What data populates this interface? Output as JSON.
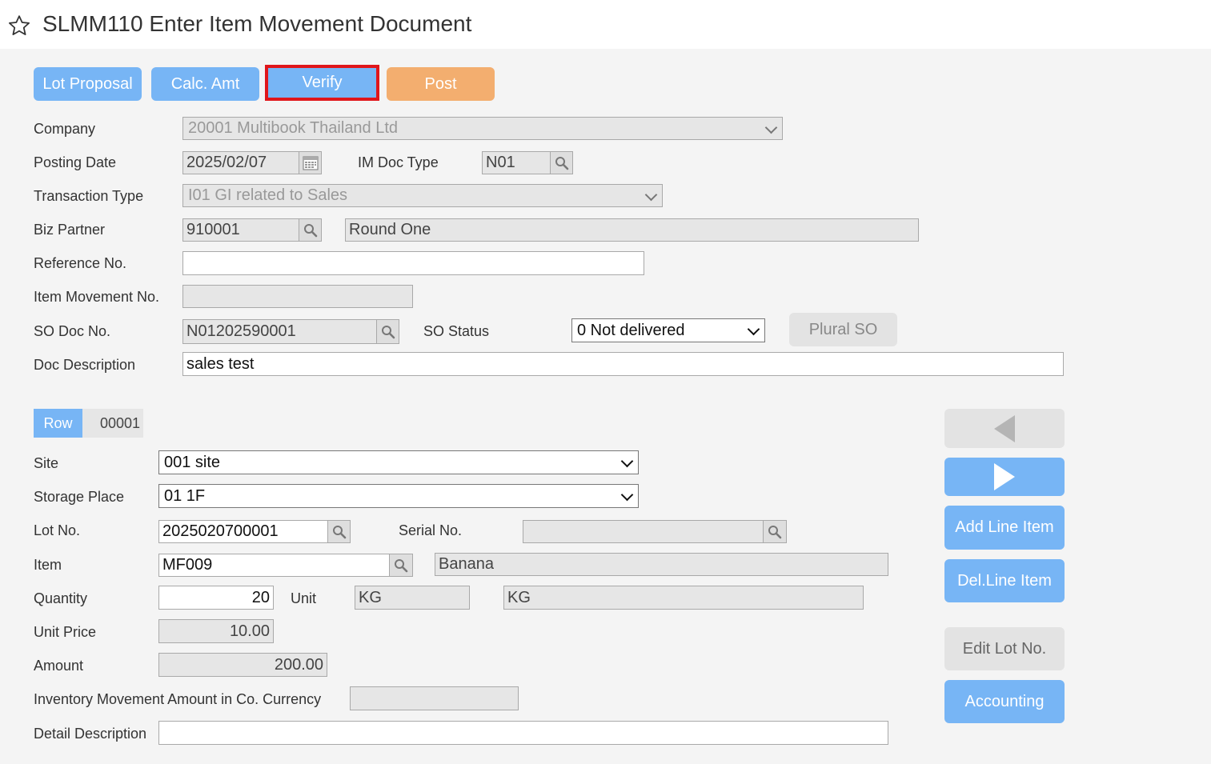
{
  "header": {
    "title": "SLMM110 Enter Item Movement Document",
    "favorite_icon": "star-outline-icon"
  },
  "toolbar": {
    "lot_proposal": "Lot Proposal",
    "calc_amt": "Calc. Amt",
    "verify": "Verify",
    "post": "Post"
  },
  "form": {
    "company_label": "Company",
    "company_value": "20001 Multibook Thailand Ltd",
    "posting_date_label": "Posting Date",
    "posting_date_value": "2025/02/07",
    "im_doc_type_label": "IM Doc Type",
    "im_doc_type_value": "N01",
    "transaction_type_label": "Transaction Type",
    "transaction_type_value": "I01 GI related to Sales",
    "biz_partner_label": "Biz Partner",
    "biz_partner_code": "910001",
    "biz_partner_name": "Round One",
    "reference_no_label": "Reference No.",
    "reference_no_value": "",
    "item_movement_no_label": "Item Movement No.",
    "item_movement_no_value": "",
    "so_doc_no_label": "SO Doc No.",
    "so_doc_no_value": "N01202590001",
    "so_status_label": "SO Status",
    "so_status_value": "0 Not delivered",
    "plural_so": "Plural SO",
    "doc_description_label": "Doc Description",
    "doc_description_value": "sales test"
  },
  "row": {
    "tag": "Row",
    "number": "00001",
    "site_label": "Site",
    "site_value": "001 site",
    "storage_place_label": "Storage Place",
    "storage_place_value": "01 1F",
    "lot_no_label": "Lot No.",
    "lot_no_value": "2025020700001",
    "serial_no_label": "Serial No.",
    "serial_no_value": "",
    "item_label": "Item",
    "item_code": "MF009",
    "item_name": "Banana",
    "quantity_label": "Quantity",
    "quantity_value": "20",
    "unit_label": "Unit",
    "unit_code": "KG",
    "unit_name": "KG",
    "unit_price_label": "Unit Price",
    "unit_price_value": "10.00",
    "amount_label": "Amount",
    "amount_value": "200.00",
    "inv_amount_label": "Inventory Movement Amount in Co. Currency",
    "inv_amount_value": "",
    "detail_description_label": "Detail Description",
    "detail_description_value": ""
  },
  "side_buttons": {
    "add_line_item": "Add Line Item",
    "del_line_item": "Del.Line Item",
    "edit_lot_no": "Edit Lot No.",
    "accounting": "Accounting"
  },
  "colors": {
    "primary": "#77b5f5",
    "post": "#f3ae6f",
    "highlight": "#e0161b"
  }
}
